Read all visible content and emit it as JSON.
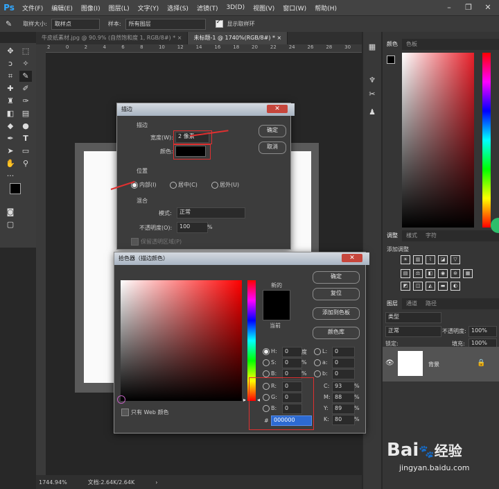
{
  "menubar": {
    "logo": "Ps",
    "items": [
      "文件(F)",
      "编辑(E)",
      "图像(I)",
      "图层(L)",
      "文字(Y)",
      "选择(S)",
      "滤镜(T)",
      "3D(D)",
      "视图(V)",
      "窗口(W)",
      "帮助(H)"
    ],
    "controls": [
      "–",
      "❐",
      "✕"
    ]
  },
  "options": {
    "sample_size_label": "取样大小:",
    "sample_size_value": "取样点",
    "sample_label": "样本:",
    "sample_value": "所有图层",
    "show_ring_label": "显示取样环"
  },
  "tabs": [
    {
      "label": "牛皮纸素材.jpg @ 90.9% (自然饱和度 1, RGB/8#) *  ×",
      "active": false
    },
    {
      "label": "未标题-1 @ 1740%(RGB/8#) *  ×",
      "active": true
    }
  ],
  "ruler": {
    "ticks": [
      "2",
      "0",
      "2",
      "4",
      "6",
      "8",
      "10",
      "12",
      "14",
      "16",
      "18",
      "20",
      "22",
      "24",
      "26",
      "28",
      "30"
    ]
  },
  "status": {
    "zoom": "1744.94%",
    "doc": "文档:2.64K/2.64K",
    "arrow": "›"
  },
  "color_panel": {
    "tabs": [
      "颜色",
      "色板"
    ]
  },
  "adjust_panel": {
    "tabs": [
      "调整",
      "樣式",
      "字符"
    ],
    "add_label": "添加调整"
  },
  "layers_panel": {
    "tabs": [
      "图层",
      "通道",
      "路径"
    ],
    "kind": "类型",
    "mode": "正常",
    "opacity_label": "不透明度:",
    "opacity": "100%",
    "lock_label": "锁定:",
    "fill_label": "填充:",
    "fill": "100%",
    "layer_name": "背景"
  },
  "stroke_dialog": {
    "title": "描边",
    "close": "✕",
    "section_stroke": "描边",
    "width_label": "宽度(W):",
    "width_value": "2 像素",
    "color_label": "颜色:",
    "section_position": "位置",
    "pos_inside": "内部(I)",
    "pos_center": "居中(C)",
    "pos_outside": "居外(U)",
    "section_blend": "混合",
    "mode_label": "模式:",
    "mode_value": "正常",
    "opacity_label": "不透明度(O):",
    "opacity_value": "100",
    "opacity_unit": "%",
    "preserve_label": "保留透明区域(P)",
    "ok": "确定",
    "cancel": "取消"
  },
  "picker_dialog": {
    "title": "拾色器（描边颜色）",
    "close": "✕",
    "new_label": "新的",
    "current_label": "当前",
    "ok": "确定",
    "reset": "复位",
    "add_swatch": "添加到色板",
    "library": "颜色库",
    "web_only": "只有 Web 颜色",
    "hsb": [
      {
        "label": "H:",
        "value": "0",
        "unit": "度"
      },
      {
        "label": "S:",
        "value": "0",
        "unit": "%"
      },
      {
        "label": "B:",
        "value": "0",
        "unit": "%"
      }
    ],
    "lab": [
      {
        "label": "L:",
        "value": "0"
      },
      {
        "label": "a:",
        "value": "0"
      },
      {
        "label": "b:",
        "value": "0"
      }
    ],
    "rgb": [
      {
        "label": "R:",
        "value": "0"
      },
      {
        "label": "G:",
        "value": "0"
      },
      {
        "label": "B:",
        "value": "0"
      }
    ],
    "cmyk": [
      {
        "label": "C:",
        "value": "93",
        "unit": "%"
      },
      {
        "label": "M:",
        "value": "88",
        "unit": "%"
      },
      {
        "label": "Y:",
        "value": "89",
        "unit": "%"
      },
      {
        "label": "K:",
        "value": "80",
        "unit": "%"
      }
    ],
    "hex_label": "#",
    "hex_value": "000000"
  },
  "watermark": {
    "brand": "Bai",
    "brand2": "经验",
    "url": "jingyan.baidu.com"
  },
  "colors": {
    "accent_red": "#e03030",
    "hue_top": "#ff0000",
    "picked": "#000000"
  }
}
